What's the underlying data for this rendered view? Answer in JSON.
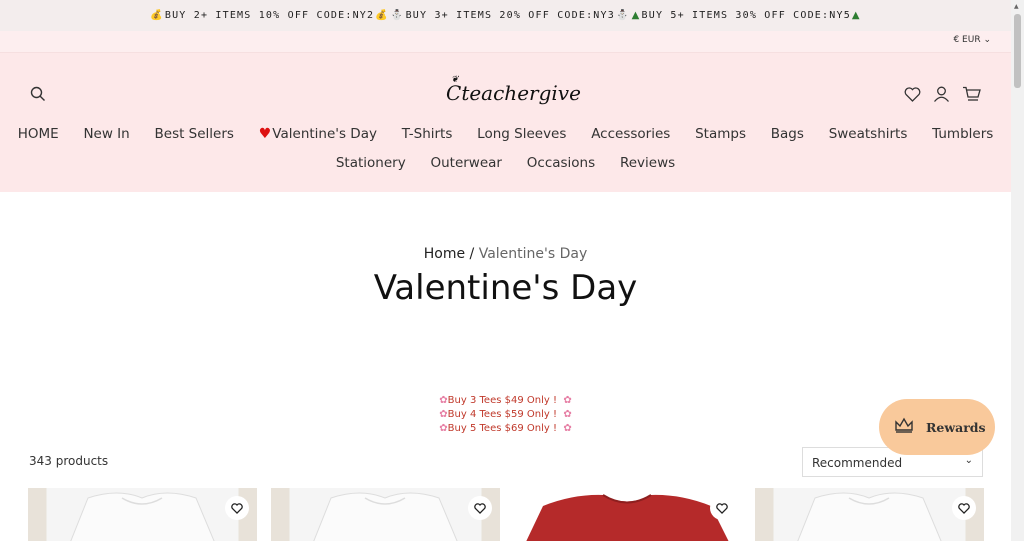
{
  "announcement": {
    "part1": "BUY 2+ ITEMS 10% OFF CODE:NY2",
    "part2": "BUY 3+ ITEMS 20% OFF CODE:NY3",
    "part3": "BUY 5+ ITEMS 30% OFF CODE:NY5",
    "icon1": "money-bag-icon",
    "icon2": "snowman-icon",
    "icon3": "christmas-tree-icon"
  },
  "currency": {
    "label": "€ EUR"
  },
  "logo": {
    "text": "teachergive",
    "lead": "C"
  },
  "nav": {
    "row1": [
      "HOME",
      "New In",
      "Best Sellers",
      "Valentine's Day",
      "T-Shirts",
      "Long Sleeves",
      "Accessories",
      "Stamps",
      "Bags",
      "Sweatshirts",
      "Tumblers"
    ],
    "row2": [
      "Stationery",
      "Outerwear",
      "Occasions",
      "Reviews"
    ]
  },
  "breadcrumb": {
    "home": "Home",
    "sep": "/",
    "current": "Valentine's Day"
  },
  "page": {
    "title": "Valentine's Day"
  },
  "promo": {
    "lines": [
      "Buy 3 Tees $49 Only !",
      "Buy 4 Tees $59 Only !",
      "Buy 5 Tees $69 Only !"
    ]
  },
  "products": {
    "count": "343 products"
  },
  "sort": {
    "selected": "Recommended"
  },
  "rewards": {
    "label": "Rewards"
  },
  "colors": {
    "header_bg": "#fde8e9",
    "rewards_bg": "#f9c99b",
    "promo_text": "#c0392b",
    "heart": "#dd1111"
  }
}
